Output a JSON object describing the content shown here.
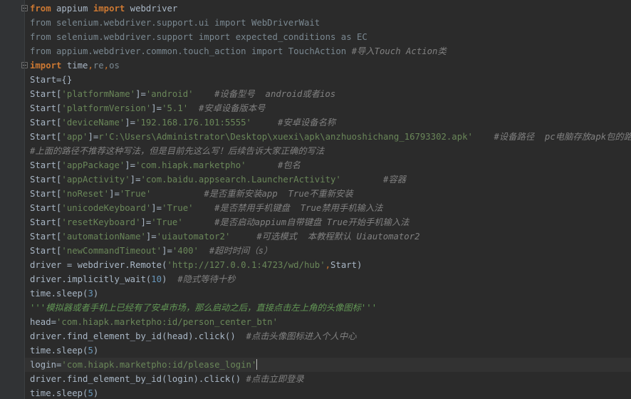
{
  "editor": {
    "lines": [
      [
        {
          "t": "from",
          "c": "kw"
        },
        {
          "t": " appium ",
          "c": "tx"
        },
        {
          "t": "import",
          "c": "kw"
        },
        {
          "t": " webdriver",
          "c": "tx"
        }
      ],
      [
        {
          "t": "from selenium.webdriver.support.ui import WebDriverWait",
          "c": "dim"
        }
      ],
      [
        {
          "t": "from selenium.webdriver.support import expected_conditions as EC",
          "c": "dim"
        }
      ],
      [
        {
          "t": "from appium.webdriver.common.touch_action import TouchAction ",
          "c": "dim"
        },
        {
          "t": "#导入Touch Action类",
          "c": "cm"
        }
      ],
      [
        {
          "t": "import",
          "c": "kw"
        },
        {
          "t": " time",
          "c": "tx"
        },
        {
          "t": ",",
          "c": "pn"
        },
        {
          "t": "re",
          "c": "dim"
        },
        {
          "t": ",",
          "c": "pn"
        },
        {
          "t": "os",
          "c": "dim"
        }
      ],
      [
        {
          "t": "Start={}",
          "c": "tx"
        }
      ],
      [
        {
          "t": "Start[",
          "c": "tx"
        },
        {
          "t": "'platformName'",
          "c": "st"
        },
        {
          "t": "]=",
          "c": "tx"
        },
        {
          "t": "'android'",
          "c": "st"
        },
        {
          "t": "    ",
          "c": "tx"
        },
        {
          "t": "#设备型号  android或者ios",
          "c": "cm"
        }
      ],
      [
        {
          "t": "Start[",
          "c": "tx"
        },
        {
          "t": "'platformVersion'",
          "c": "st"
        },
        {
          "t": "]=",
          "c": "tx"
        },
        {
          "t": "'5.1'",
          "c": "st"
        },
        {
          "t": "  ",
          "c": "tx"
        },
        {
          "t": "#安卓设备版本号",
          "c": "cm"
        }
      ],
      [
        {
          "t": "Start[",
          "c": "tx"
        },
        {
          "t": "'deviceName'",
          "c": "st"
        },
        {
          "t": "]=",
          "c": "tx"
        },
        {
          "t": "'192.168.176.101:5555'",
          "c": "st"
        },
        {
          "t": "     ",
          "c": "tx"
        },
        {
          "t": "#安卓设备名称",
          "c": "cm"
        }
      ],
      [
        {
          "t": "Start[",
          "c": "tx"
        },
        {
          "t": "'app'",
          "c": "st"
        },
        {
          "t": "]=",
          "c": "tx"
        },
        {
          "t": "r'C:\\Users\\Administrator\\Desktop\\xuexi\\apk\\anzhuoshichang_16793302.apk'",
          "c": "st"
        },
        {
          "t": "    ",
          "c": "tx"
        },
        {
          "t": "#设备路径  pc电脑存放apk包的路径",
          "c": "cm"
        }
      ],
      [
        {
          "t": "#上面的路径不推荐这种写法，但是目前先这么写！后续告诉大家正确的写法",
          "c": "cm"
        }
      ],
      [
        {
          "t": "Start[",
          "c": "tx"
        },
        {
          "t": "'appPackage'",
          "c": "st"
        },
        {
          "t": "]=",
          "c": "tx"
        },
        {
          "t": "'com.hiapk.marketpho'",
          "c": "st"
        },
        {
          "t": "      ",
          "c": "tx"
        },
        {
          "t": "#包名",
          "c": "cm"
        }
      ],
      [
        {
          "t": "Start[",
          "c": "tx"
        },
        {
          "t": "'appActivity'",
          "c": "st"
        },
        {
          "t": "]=",
          "c": "tx"
        },
        {
          "t": "'com.baidu.appsearch.LauncherActivity'",
          "c": "st"
        },
        {
          "t": "        ",
          "c": "tx"
        },
        {
          "t": "#容器",
          "c": "cm"
        }
      ],
      [
        {
          "t": "Start[",
          "c": "tx"
        },
        {
          "t": "'noReset'",
          "c": "st"
        },
        {
          "t": "]=",
          "c": "tx"
        },
        {
          "t": "'True'",
          "c": "st"
        },
        {
          "t": "          ",
          "c": "tx"
        },
        {
          "t": "#是否重新安装app  True不重新安装",
          "c": "cm"
        }
      ],
      [
        {
          "t": "Start[",
          "c": "tx"
        },
        {
          "t": "'unicodeKeyboard'",
          "c": "st"
        },
        {
          "t": "]=",
          "c": "tx"
        },
        {
          "t": "'True'",
          "c": "st"
        },
        {
          "t": "    ",
          "c": "tx"
        },
        {
          "t": "#是否禁用手机键盘  True禁用手机输入法",
          "c": "cm"
        }
      ],
      [
        {
          "t": "Start[",
          "c": "tx"
        },
        {
          "t": "'resetKeyboard'",
          "c": "st"
        },
        {
          "t": "]=",
          "c": "tx"
        },
        {
          "t": "'True'",
          "c": "st"
        },
        {
          "t": "      ",
          "c": "tx"
        },
        {
          "t": "#是否启动appium自带键盘 True开始手机输入法",
          "c": "cm"
        }
      ],
      [
        {
          "t": "Start[",
          "c": "tx"
        },
        {
          "t": "'automationName'",
          "c": "st"
        },
        {
          "t": "]=",
          "c": "tx"
        },
        {
          "t": "'uiautomator2'",
          "c": "st"
        },
        {
          "t": "     ",
          "c": "tx"
        },
        {
          "t": "#可选模式  本教程默认 Uiautomator2",
          "c": "cm"
        }
      ],
      [
        {
          "t": "Start[",
          "c": "tx"
        },
        {
          "t": "'newCommandTimeout'",
          "c": "st"
        },
        {
          "t": "]=",
          "c": "tx"
        },
        {
          "t": "'400'",
          "c": "st"
        },
        {
          "t": "  ",
          "c": "tx"
        },
        {
          "t": "#超时时间（s）",
          "c": "cm"
        }
      ],
      [
        {
          "t": "driver = webdriver.Remote(",
          "c": "tx"
        },
        {
          "t": "'http://127.0.0.1:4723/wd/hub'",
          "c": "st"
        },
        {
          "t": ",",
          "c": "pn"
        },
        {
          "t": "Start)",
          "c": "tx"
        }
      ],
      [
        {
          "t": "driver.implicitly_wait(",
          "c": "tx"
        },
        {
          "t": "10",
          "c": "nm"
        },
        {
          "t": ")  ",
          "c": "tx"
        },
        {
          "t": "#隐式等待十秒",
          "c": "cm"
        }
      ],
      [
        {
          "t": "time.sleep(",
          "c": "tx"
        },
        {
          "t": "3",
          "c": "nm"
        },
        {
          "t": ")",
          "c": "tx"
        }
      ],
      [
        {
          "t": "'''模拟器或者手机上已经有了安卓市场，那么启动之后，直接点击左上角的头像图标'''",
          "c": "dc"
        }
      ],
      [
        {
          "t": "head=",
          "c": "tx"
        },
        {
          "t": "'com.hiapk.marketpho:id/person_center_btn'",
          "c": "st"
        }
      ],
      [
        {
          "t": "driver.find_element_by_id(head).click()  ",
          "c": "tx"
        },
        {
          "t": "#点击头像图标进入个人中心",
          "c": "cm"
        }
      ],
      [
        {
          "t": "time.sleep(",
          "c": "tx"
        },
        {
          "t": "5",
          "c": "nm"
        },
        {
          "t": ")",
          "c": "tx"
        }
      ],
      [
        {
          "t": "login=",
          "c": "tx"
        },
        {
          "t": "'com.hiapk.marketpho:id/please_login'",
          "c": "st"
        }
      ],
      [
        {
          "t": "driver.find_element_by_id(login).click() ",
          "c": "tx"
        },
        {
          "t": "#点击立即登录",
          "c": "cm"
        }
      ],
      [
        {
          "t": "time.sleep(",
          "c": "tx"
        },
        {
          "t": "5",
          "c": "nm"
        },
        {
          "t": ")",
          "c": "tx"
        }
      ]
    ]
  },
  "colors": {
    "background": "#2b2b2b",
    "gutter": "#313335",
    "keyword": "#cc7832",
    "string": "#6a8759",
    "number": "#6897bb",
    "comment": "#808080",
    "text": "#a9b7c6"
  },
  "icons": [
    "fold-marker-icon"
  ]
}
